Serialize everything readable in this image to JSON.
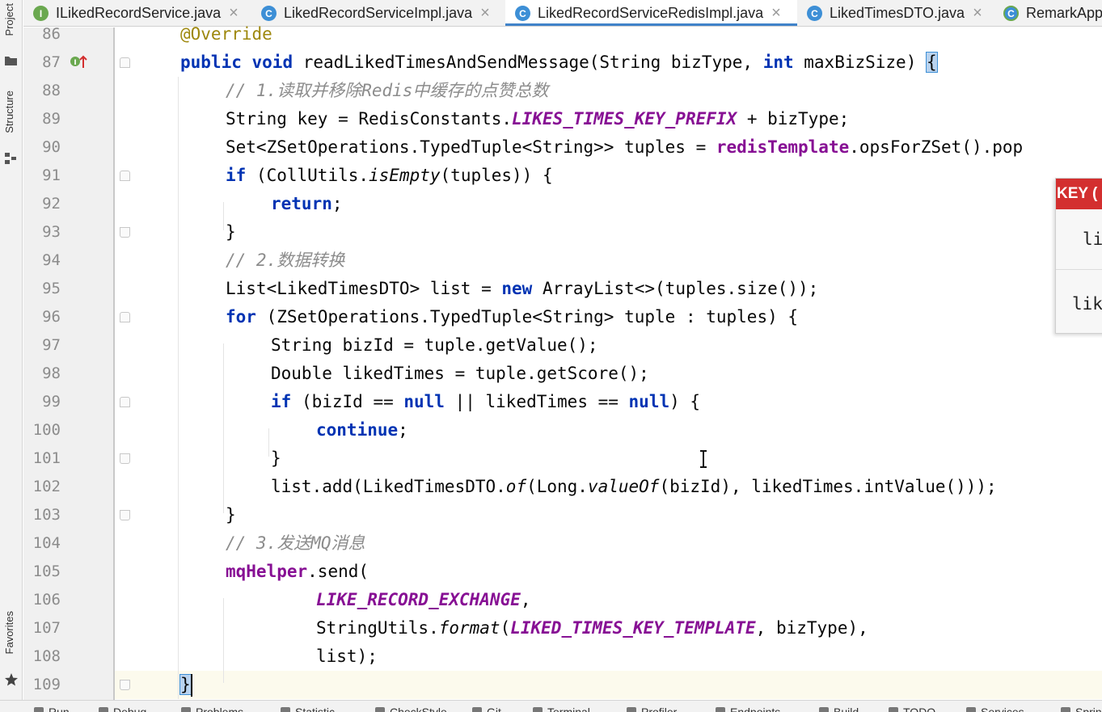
{
  "left_strip": {
    "project_label": "Project",
    "structure_label": "Structure",
    "favorites_label": "Favorites"
  },
  "tabs": [
    {
      "label": "ILikedRecordService.java",
      "icon": "interface-icon",
      "active": false
    },
    {
      "label": "LikedRecordServiceImpl.java",
      "icon": "class-icon",
      "active": false
    },
    {
      "label": "LikedRecordServiceRedisImpl.java",
      "icon": "class-icon",
      "active": true
    },
    {
      "label": "LikedTimesDTO.java",
      "icon": "class-icon",
      "active": false
    },
    {
      "label": "RemarkApp",
      "icon": "spring-boot-class-icon",
      "active": false
    }
  ],
  "editor": {
    "line_numbers": [
      "86",
      "87",
      "88",
      "89",
      "90",
      "91",
      "92",
      "93",
      "94",
      "95",
      "96",
      "97",
      "98",
      "99",
      "100",
      "101",
      "102",
      "103",
      "104",
      "105",
      "106",
      "107",
      "108",
      "109"
    ],
    "gutter_marker_line": "87",
    "code": {
      "l86_annotation": "@Override",
      "l87_public": "public",
      "l87_void": "void",
      "l87_sig": " readLikedTimesAndSendMessage(String bizType, ",
      "l87_int": "int",
      "l87_rest": " maxBizSize) ",
      "l87_brace": "{",
      "l88_comment": "// 1.读取并移除Redis中缓存的点赞总数",
      "l89_a": "String key = RedisConstants.",
      "l89_const": "LIKES_TIMES_KEY_PREFIX",
      "l89_b": " + bizType;",
      "l90_a": "Set<ZSetOperations.TypedTuple<String>> tuples = ",
      "l90_field": "redisTemplate",
      "l90_b": ".opsForZSet().pop",
      "l91_if": "if",
      "l91_a": " (CollUtils.",
      "l91_method": "isEmpty",
      "l91_b": "(tuples)) {",
      "l92_return": "return",
      "l92_semi": ";",
      "l93_close": "}",
      "l94_comment": "// 2.数据转换",
      "l95_a": "List<LikedTimesDTO> list = ",
      "l95_new": "new",
      "l95_b": " ArrayList<>(tuples.size());",
      "l96_for": "for",
      "l96_a": " (ZSetOperations.TypedTuple<String> tuple : tuples) {",
      "l97": "String bizId = tuple.getValue();",
      "l98": "Double likedTimes = tuple.getScore();",
      "l99_if": "if",
      "l99_a": " (bizId == ",
      "l99_null1": "null",
      "l99_b": " || likedTimes == ",
      "l99_null2": "null",
      "l99_c": ") {",
      "l100_continue": "continue",
      "l100_semi": ";",
      "l101_close": "}",
      "l102_a": "list.add(LikedTimesDTO.",
      "l102_of": "of",
      "l102_b": "(Long.",
      "l102_valueof": "valueOf",
      "l102_c": "(bizId), likedTimes.intValue()));",
      "l103_close": "}",
      "l104_comment": "// 3.发送MQ消息",
      "l105_field": "mqHelper",
      "l105_a": ".send(",
      "l106_const": "LIKE_RECORD_EXCHANGE",
      "l106_a": ",",
      "l107_a": "StringUtils.",
      "l107_format": "format",
      "l107_b": "(",
      "l107_const": "LIKED_TIMES_KEY_TEMPLATE",
      "l107_c": ", bizType),",
      "l108": "list);",
      "l109_close": "}"
    }
  },
  "popup": {
    "header": "KEY (",
    "row1": "li",
    "row2": "lik"
  },
  "bottom_tools": [
    "Run",
    "Debug",
    "Problems",
    "Statistic",
    "CheckStyle",
    "Git",
    "Terminal",
    "Profiler",
    "Endpoints",
    "Build",
    "TODO",
    "Services",
    "Spring"
  ],
  "colors": {
    "keyword": "#0033b3",
    "annotation": "#9e880d",
    "comment": "#8c8c8c",
    "constant": "#871094",
    "active_tab_underline": "#4083c9",
    "popup_header": "#d32f2f"
  }
}
